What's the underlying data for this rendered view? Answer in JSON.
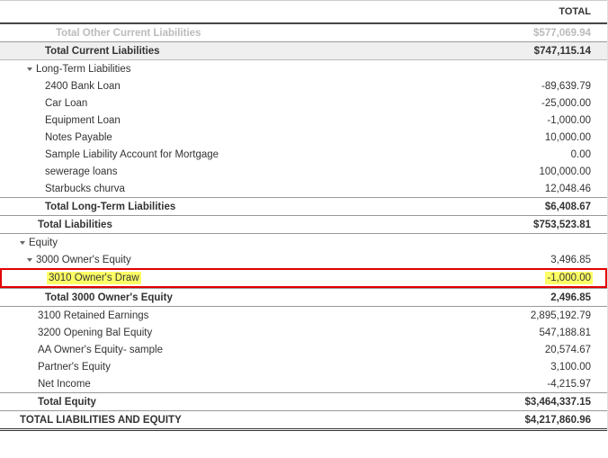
{
  "header": {
    "total_label": "TOTAL"
  },
  "rows": {
    "other_current_liab": {
      "label": "Total Other Current Liabilities",
      "value": "$577,069.94"
    },
    "total_current_liab": {
      "label": "Total Current Liabilities",
      "value": "$747,115.14"
    },
    "long_term_liab_header": {
      "label": "Long-Term Liabilities"
    },
    "bank_loan": {
      "label": "2400 Bank Loan",
      "value": "-89,639.79"
    },
    "car_loan": {
      "label": "Car Loan",
      "value": "-25,000.00"
    },
    "equipment_loan": {
      "label": "Equipment Loan",
      "value": "-1,000.00"
    },
    "notes_payable": {
      "label": "Notes Payable",
      "value": "10,000.00"
    },
    "sample_mortgage": {
      "label": "Sample Liability Account for Mortgage",
      "value": "0.00"
    },
    "sewerage": {
      "label": "sewerage loans",
      "value": "100,000.00"
    },
    "starbucks": {
      "label": "Starbucks churva",
      "value": "12,048.46"
    },
    "total_long_term": {
      "label": "Total Long-Term Liabilities",
      "value": "$6,408.67"
    },
    "total_liabilities": {
      "label": "Total Liabilities",
      "value": "$753,523.81"
    },
    "equity_header": {
      "label": "Equity"
    },
    "owners_equity_header": {
      "label": "3000 Owner's Equity",
      "value": "3,496.85"
    },
    "owners_draw": {
      "label": "3010 Owner's Draw",
      "value": "-1,000.00"
    },
    "total_owners_equity": {
      "label": "Total 3000 Owner's Equity",
      "value": "2,496.85"
    },
    "retained_earnings": {
      "label": "3100 Retained Earnings",
      "value": "2,895,192.79"
    },
    "opening_bal": {
      "label": "3200 Opening Bal Equity",
      "value": "547,188.81"
    },
    "aa_owners": {
      "label": "AA Owner's Equity- sample",
      "value": "20,574.67"
    },
    "partners_equity": {
      "label": "Partner's Equity",
      "value": "3,100.00"
    },
    "net_income": {
      "label": "Net Income",
      "value": "-4,215.97"
    },
    "total_equity": {
      "label": "Total Equity",
      "value": "$3,464,337.15"
    },
    "total_liab_equity": {
      "label": "TOTAL LIABILITIES AND EQUITY",
      "value": "$4,217,860.96"
    }
  }
}
